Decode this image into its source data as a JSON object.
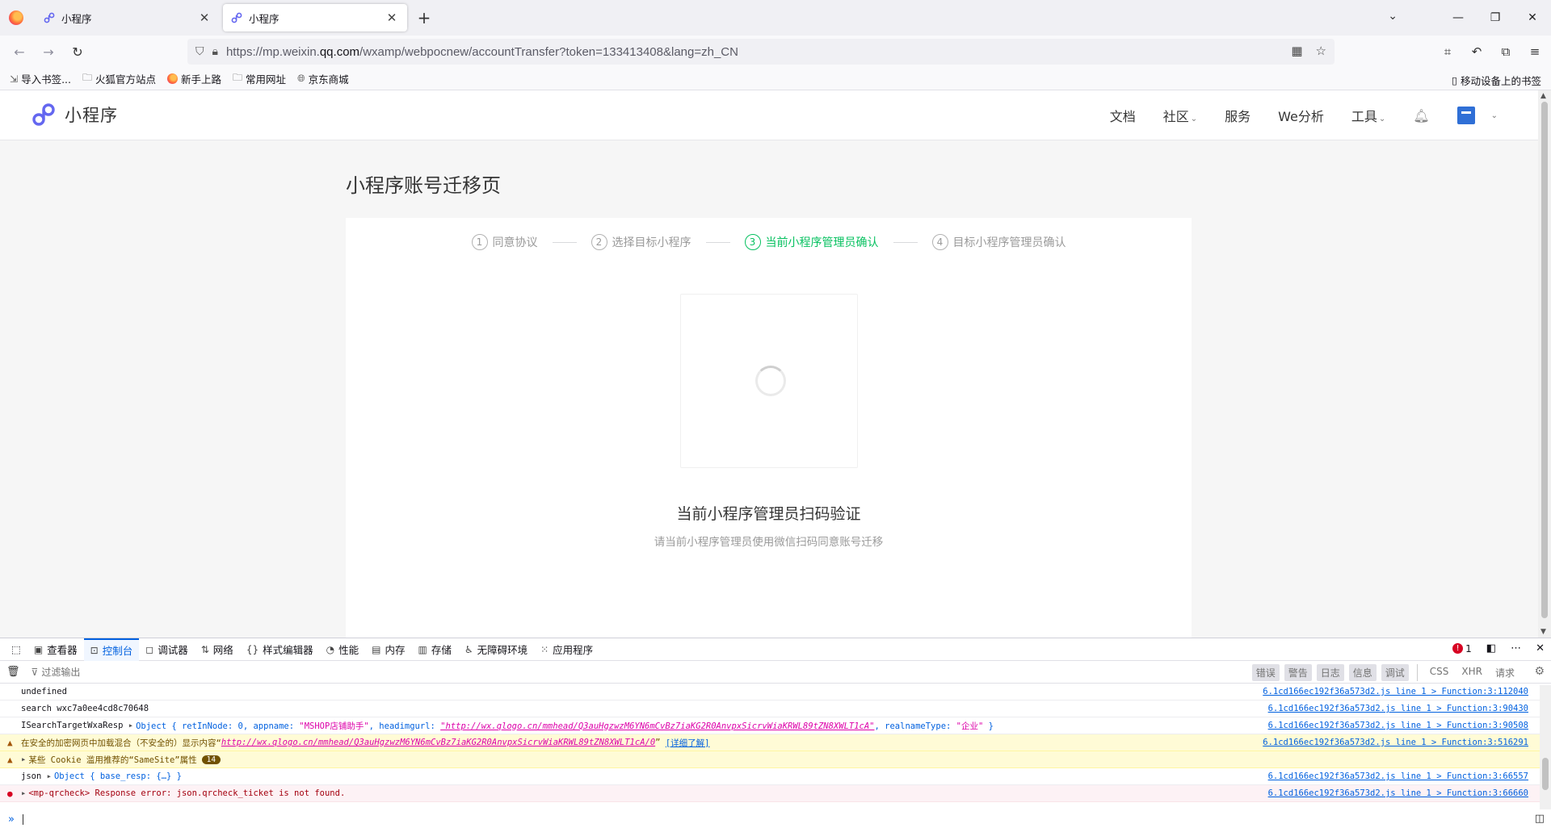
{
  "browser": {
    "tabs": [
      {
        "title": "小程序",
        "state": "inactive"
      },
      {
        "title": "小程序",
        "state": "active"
      }
    ],
    "new_tab": "+",
    "url_prefix": "https://mp.weixin.",
    "url_domain": "qq.com",
    "url_suffix": "/wxamp/webpocnew/accountTransfer?token=133413408&lang=zh_CN",
    "bookmarks": [
      {
        "label": "导入书签...",
        "icon": "import-icon"
      },
      {
        "label": "火狐官方站点",
        "icon": "folder-icon"
      },
      {
        "label": "新手上路",
        "icon": "firefox-icon"
      },
      {
        "label": "常用网址",
        "icon": "folder-icon"
      },
      {
        "label": "京东商城",
        "icon": "globe-icon"
      }
    ],
    "mobile_bookmarks": "移动设备上的书签"
  },
  "site": {
    "brand": "小程序",
    "brand_color": "#6467f0",
    "nav": [
      {
        "label": "文档",
        "dropdown": false
      },
      {
        "label": "社区",
        "dropdown": true
      },
      {
        "label": "服务",
        "dropdown": false
      },
      {
        "label": "We分析",
        "dropdown": false
      },
      {
        "label": "工具",
        "dropdown": true
      }
    ]
  },
  "page": {
    "title": "小程序账号迁移页",
    "steps": [
      {
        "num": "1",
        "label": "同意协议",
        "current": false
      },
      {
        "num": "2",
        "label": "选择目标小程序",
        "current": false
      },
      {
        "num": "3",
        "label": "当前小程序管理员确认",
        "current": true
      },
      {
        "num": "4",
        "label": "目标小程序管理员确认",
        "current": false
      }
    ],
    "accent_color": "#07c160",
    "scan_title": "当前小程序管理员扫码验证",
    "scan_subtitle": "请当前小程序管理员使用微信扫码同意账号迁移"
  },
  "devtools": {
    "tabs": [
      {
        "label": "查看器",
        "icon": "inspector-icon"
      },
      {
        "label": "控制台",
        "icon": "console-icon",
        "selected": true
      },
      {
        "label": "调试器",
        "icon": "debugger-icon"
      },
      {
        "label": "网络",
        "icon": "network-icon"
      },
      {
        "label": "样式编辑器",
        "icon": "style-editor-icon"
      },
      {
        "label": "性能",
        "icon": "performance-icon"
      },
      {
        "label": "内存",
        "icon": "memory-icon"
      },
      {
        "label": "存储",
        "icon": "storage-icon"
      },
      {
        "label": "无障碍环境",
        "icon": "accessibility-icon"
      },
      {
        "label": "应用程序",
        "icon": "application-icon"
      }
    ],
    "error_count": "1",
    "filter_placeholder": "过滤输出",
    "filters": [
      "错误",
      "警告",
      "日志",
      "信息",
      "调试"
    ],
    "filters_extra": [
      "CSS",
      "XHR",
      "请求"
    ],
    "logs": {
      "l1": {
        "text": "undefined",
        "src": "6.1cd166ec192f36a573d2.js line 1 > Function:3:112040"
      },
      "l2": {
        "text": "search wxc7a0ee4cd8c70648",
        "src": "6.1cd166ec192f36a573d2.js line 1 > Function:3:90430"
      },
      "l3": {
        "label": "ISearchTargetWxaResp",
        "obj_start": "Object { retInNode: 0, appname: ",
        "appname": "\"MSHOP店铺助手\"",
        "mid": ", headimgurl: ",
        "headimgurl": "\"http://wx.qlogo.cn/mmhead/Q3auHgzwzM6YN6mCvBz7iaKG2R0AnvpxSicrvWiaKRWL89tZN8XWLT1cA\"",
        "mid2": ", realnameType: ",
        "realname": "\"企业\"",
        "end": " }",
        "src": "6.1cd166ec192f36a573d2.js line 1 > Function:3:90508"
      },
      "l4": {
        "text": "在安全的加密网页中加载混合（不安全的）显示内容“",
        "link": "http://wx.qlogo.cn/mmhead/Q3auHgzwzM6YN6mCvBz7iaKG2R0AnvpxSicrvWiaKRWL89tZN8XWLT1cA/0",
        "after": "”",
        "more": "[详细了解]",
        "src": "6.1cd166ec192f36a573d2.js line 1 > Function:3:516291"
      },
      "l5": {
        "text": "某些 Cookie 滥用推荐的“SameSite”属性",
        "count": "14"
      },
      "l6": {
        "label": "json",
        "obj": "Object { base_resp: {…} }",
        "src": "6.1cd166ec192f36a573d2.js line 1 > Function:3:66557"
      },
      "l7": {
        "text": "<mp-qrcheck> Response error: json.qrcheck_ticket is not found.",
        "src": "6.1cd166ec192f36a573d2.js line 1 > Function:3:66660"
      }
    },
    "prompt": "»"
  }
}
